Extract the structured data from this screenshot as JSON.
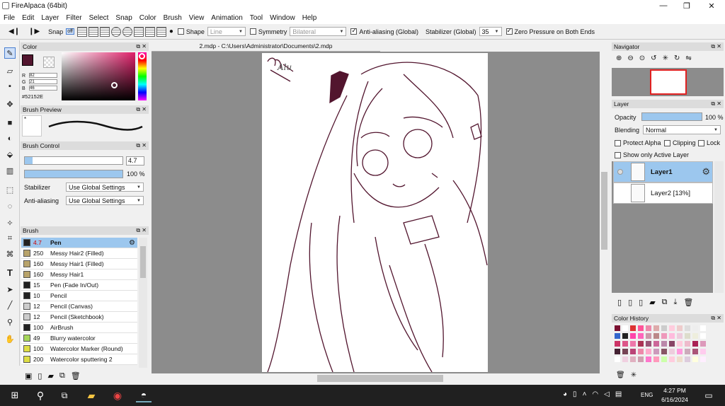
{
  "window": {
    "title": "FireAlpaca (64bit)",
    "minimize": "—",
    "maximize": "❐",
    "close": "✕"
  },
  "menu": [
    "File",
    "Edit",
    "Layer",
    "Filter",
    "Select",
    "Snap",
    "Color",
    "Brush",
    "View",
    "Animation",
    "Tool",
    "Window",
    "Help"
  ],
  "toolbar": {
    "snap_label": "Snap",
    "snap_off": "off",
    "shape_label": "Shape",
    "shape_value": "Line",
    "symmetry_label": "Symmetry",
    "symmetry_value": "Bilateral",
    "antialias_label": "Anti-aliasing (Global)",
    "stabilizer_label": "Stabilizer (Global)",
    "stabilizer_value": "35",
    "zero_pressure_label": "Zero Pressure on Both Ends"
  },
  "color_panel": {
    "title": "Color",
    "r_label": "R",
    "g_label": "G",
    "b_label": "B",
    "r": "82",
    "g": "21",
    "b": "46",
    "hex": "#52152E",
    "color": "#52152E"
  },
  "brush_preview": {
    "title": "Brush Preview",
    "marker": "*"
  },
  "brush_control": {
    "title": "Brush Control",
    "size": "4.7",
    "opacity": "100 %",
    "stabilizer_label": "Stabilizer",
    "stabilizer_value": "Use Global Settings",
    "antialias_label": "Anti-aliasing",
    "antialias_value": "Use Global Settings"
  },
  "brush_panel": {
    "title": "Brush",
    "items": [
      {
        "size": "4.7",
        "name": "Pen",
        "color": "#222222",
        "selected": true
      },
      {
        "size": "250",
        "name": "Messy Hair2 (Filled)",
        "color": "#b8a36a"
      },
      {
        "size": "160",
        "name": "Messy Hair1 (Filled)",
        "color": "#b8a36a"
      },
      {
        "size": "160",
        "name": "Messy Hair1",
        "color": "#b8a36a"
      },
      {
        "size": "15",
        "name": "Pen (Fade In/Out)",
        "color": "#222222"
      },
      {
        "size": "10",
        "name": "Pencil",
        "color": "#222222"
      },
      {
        "size": "12",
        "name": "Pencil (Canvas)",
        "color": "#cccccc"
      },
      {
        "size": "12",
        "name": "Pencil (Sketchbook)",
        "color": "#cccccc"
      },
      {
        "size": "100",
        "name": "AirBrush",
        "color": "#222222"
      },
      {
        "size": "49",
        "name": "Blurry watercolor",
        "color": "#a6d65a"
      },
      {
        "size": "100",
        "name": "Watercolor Marker (Round)",
        "color": "#dddd44"
      },
      {
        "size": "200",
        "name": "Watercolor sputtering 2",
        "color": "#dddd44"
      }
    ]
  },
  "document": {
    "tab": "2.mdp - C:\\Users\\Administrator\\Documents\\2.mdp",
    "signature": "Alu"
  },
  "navigator": {
    "title": "Navigator"
  },
  "layer_panel": {
    "title": "Layer",
    "opacity_label": "Opacity",
    "opacity_value": "100 %",
    "opacity_fraction": 1.0,
    "blending_label": "Blending",
    "blending_value": "Normal",
    "protect_alpha": "Protect Alpha",
    "clipping": "Clipping",
    "lock": "Lock",
    "show_active": "Show only Active Layer",
    "layers": [
      {
        "name": "Layer1",
        "selected": true
      },
      {
        "name": "Layer2 [13%]",
        "selected": false
      }
    ]
  },
  "color_history": {
    "title": "Color History",
    "colors": [
      "#7a1030",
      "#ffffff",
      "#d33",
      "#f59",
      "#e8a",
      "#daa",
      "#ccc",
      "#fcd",
      "#ecc",
      "#ddd",
      "#eee",
      "#fff",
      "#3366cc",
      "#222222",
      "#f4a",
      "#f6b",
      "#c9a",
      "#b88",
      "#e9b",
      "#fbd",
      "#ecd",
      "#ddc",
      "#eed",
      "#fff",
      "#cc3366",
      "#dd5588",
      "#ee77aa",
      "#aa3355",
      "#995577",
      "#cc6699",
      "#bb88aa",
      "#884466",
      "#ffccdd",
      "#eebbcc",
      "#aa2255",
      "#dd99bb",
      "#442233",
      "#774455",
      "#bb4477",
      "#ee88aa",
      "#ffaacc",
      "#cc99bb",
      "#885566",
      "#eeccdd",
      "#f9d",
      "#cab",
      "#a57",
      "#fce",
      "#ffffff",
      "#f0d0e0",
      "#e0b0c0",
      "#d0a0b0",
      "#f7c",
      "#f9b",
      "#cfa",
      "#fcd",
      "#edc",
      "#dcd",
      "#ffd",
      "#fef"
    ]
  },
  "taskbar": {
    "time": "4:27 PM",
    "date": "6/16/2024",
    "lang": "ENG"
  }
}
